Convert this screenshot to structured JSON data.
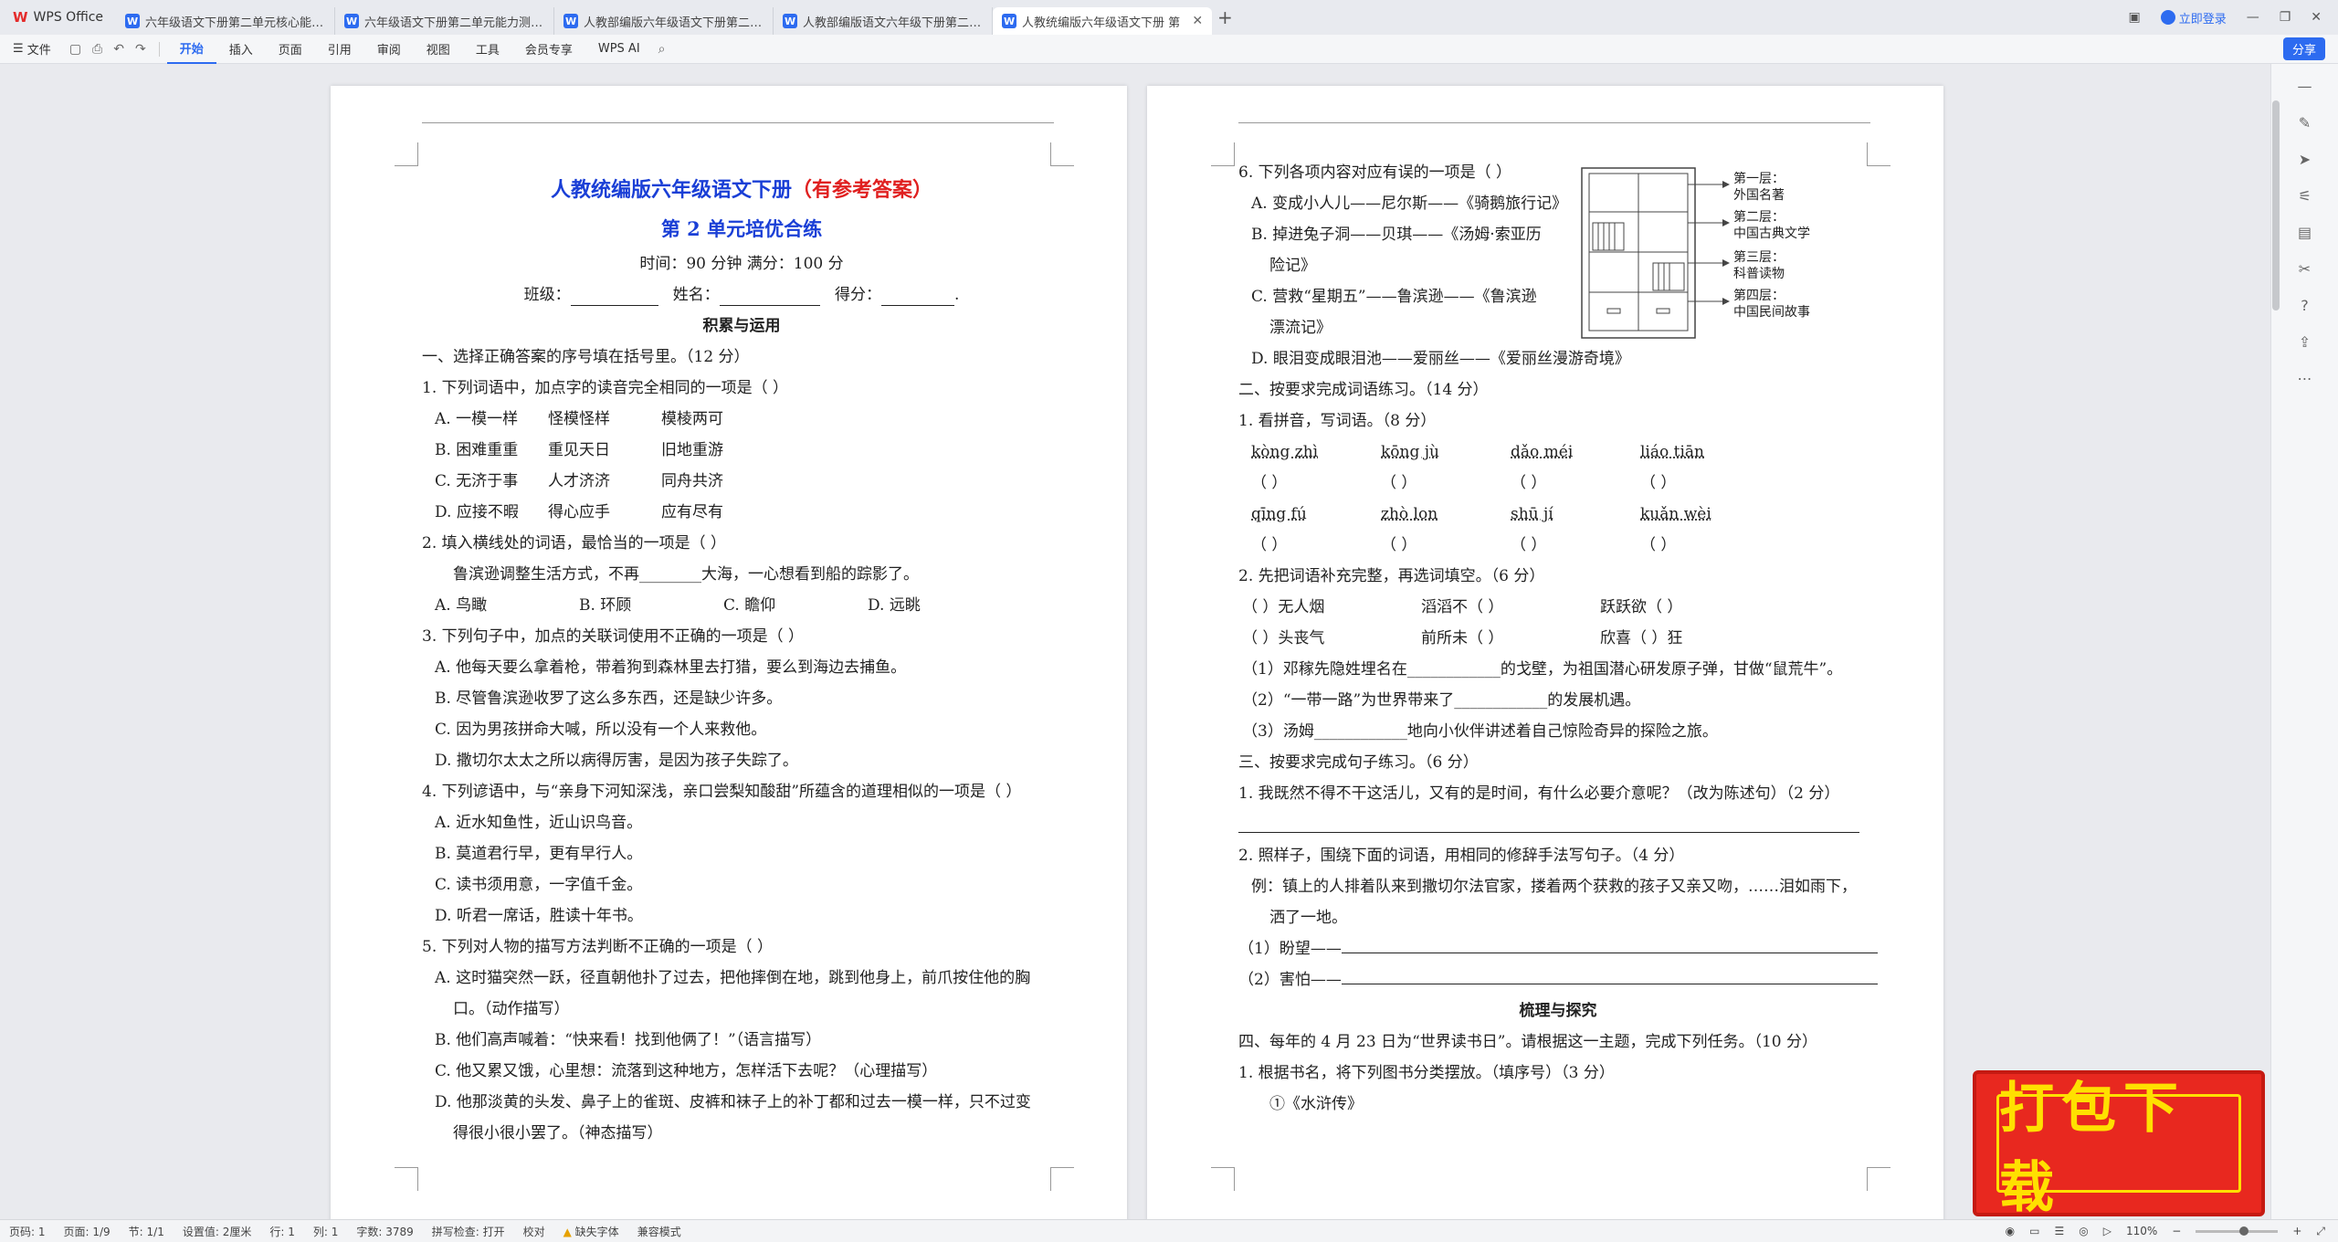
{
  "app": {
    "name": "WPS Office",
    "login": "立即登录",
    "share": "分享"
  },
  "tabs": [
    {
      "label": "六年级语文下册第二单元核心能力达标"
    },
    {
      "label": "六年级语文下册第二单元能力测试卷"
    },
    {
      "label": "人教部编版六年级语文下册第二单元"
    },
    {
      "label": "人教部编版语文六年级下册第二单元"
    },
    {
      "label": "人教统编版六年级语文下册 第"
    }
  ],
  "menu": {
    "file": "文件",
    "items": [
      "开始",
      "插入",
      "页面",
      "引用",
      "审阅",
      "视图",
      "工具",
      "会员专享"
    ],
    "ai": "WPS AI"
  },
  "page1": {
    "title": "人教统编版六年级语文下册",
    "title_ans": "（有参考答案）",
    "subtitle": "第 2 单元培优合练",
    "time": "时间：90 分钟  满分：100 分",
    "class_label": "班级：",
    "name_label": "姓名：",
    "score_label": "得分：",
    "section1": "积累与运用",
    "lines": [
      "一、选择正确答案的序号填在括号里。（12 分）",
      "1. 下列词语中，加点字的读音完全相同的一项是（     ）"
    ],
    "q1": [
      [
        "A. 一模一样",
        "怪模怪样",
        "模棱两可"
      ],
      [
        "B. 困难重重",
        "重见天日",
        "旧地重游"
      ],
      [
        "C. 无济于事",
        "人才济济",
        "同舟共济"
      ],
      [
        "D. 应接不暇",
        "得心应手",
        "应有尽有"
      ]
    ],
    "q2": "2. 填入横线处的词语，最恰当的一项是（     ）",
    "q2s": "鲁滨逊调整生活方式，不再________大海，一心想看到船的踪影了。",
    "q2o": [
      "A. 鸟瞰",
      "B. 环顾",
      "C. 瞻仰",
      "D. 远眺"
    ],
    "q3": "3. 下列句子中，加点的关联词使用不正确的一项是（     ）",
    "q3o": [
      "A. 他每天要么拿着枪，带着狗到森林里去打猎，要么到海边去捕鱼。",
      "B. 尽管鲁滨逊收罗了这么多东西，还是缺少许多。",
      "C. 因为男孩拼命大喊，所以没有一个人来救他。",
      "D. 撒切尔太太之所以病得厉害，是因为孩子失踪了。"
    ],
    "q4": "4. 下列谚语中，与“亲身下河知深浅，亲口尝梨知酸甜”所蕴含的道理相似的一项是（     ）",
    "q4o": [
      "A. 近水知鱼性，近山识鸟音。",
      "B. 莫道君行早，更有早行人。",
      "C. 读书须用意，一字值千金。",
      "D. 听君一席话，胜读十年书。"
    ],
    "q5": "5. 下列对人物的描写方法判断不正确的一项是（     ）",
    "q5o": [
      "A. 这时猫突然一跃，径直朝他扑了过去，把他摔倒在地，跳到他身上，前爪按住他的胸",
      "口。（动作描写）",
      "B. 他们高声喊着：“快来看！找到他俩了！”（语言描写）",
      "C. 他又累又饿，心里想：流落到这种地方，怎样活下去呢？（心理描写）",
      "D. 他那淡黄的头发、鼻子上的雀斑、皮裤和袜子上的补丁都和过去一模一样，只不过变",
      "得很小很小罢了。（神态描写）"
    ]
  },
  "page2": {
    "q6": "6. 下列各项内容对应有误的一项是（     ）",
    "q6o": [
      "A. 变成小人儿——尼尔斯——《骑鹅旅行记》",
      "B. 掉进兔子洞——贝琪——《汤姆·索亚历",
      "险记》",
      "C. 营救“星期五”——鲁滨逊——《鲁滨逊",
      "漂流记》",
      "D. 眼泪变成眼泪池——爱丽丝——《爱丽丝漫游奇境》"
    ],
    "shelf": [
      "第一层：",
      "外国名著",
      "第二层：",
      "中国古典文学",
      "第三层：",
      "科普读物",
      "第四层：",
      "中国民间故事"
    ],
    "s2": "二、按要求完成词语练习。（14 分）",
    "p1": "1. 看拼音，写词语。（8 分）",
    "pinyin1": [
      "kòng zhì",
      "kōng jù",
      "dǎo méi",
      "liáo tiān"
    ],
    "pinyin2": [
      "qīng fú",
      "zhò lon",
      "shū jí",
      "kuǎn wèi"
    ],
    "paren": "（        ）",
    "p2": "2. 先把词语补充完整，再选词填空。（6 分）",
    "fill1": [
      "（    ）无人烟",
      "滔滔不（    ）",
      "跃跃欲（    ）"
    ],
    "fill2": [
      "（    ）头丧气",
      "前所未（    ）",
      "欣喜（    ）狂"
    ],
    "f1": "（1）邓稼先隐姓埋名在____________的戈壁，为祖国潜心研发原子弹，甘做“鼠荒牛”。",
    "f2": "（2）“一带一路”为世界带来了____________的发展机遇。",
    "f3": "（3）汤姆____________地向小伙伴讲述着自己惊险奇异的探险之旅。",
    "s3": "三、按要求完成句子练习。（6 分）",
    "s3q1": "1. 我既然不得不干这活儿，又有的是时间，有什么必要介意呢？（改为陈述句）（2 分）",
    "s3q2": "2. 照样子，围绕下面的词语，用相同的修辞手法写句子。（4 分）",
    "ex1": "例：镇上的人排着队来到撒切尔法官家，搂着两个获救的孩子又亲又吻，……泪如雨下，",
    "ex2": "洒了一地。",
    "w1": "（1）盼望——",
    "w2": "（2）害怕——",
    "sec2": "梳理与探究",
    "s4": "四、每年的 4 月 23 日为“世界读书日”。请根据这一主题，完成下列任务。（10 分）",
    "s4q1": "1. 根据书名，将下列图书分类摆放。（填序号）（3 分）",
    "book1": "①《水浒传》"
  },
  "status": {
    "page": "页码: 1",
    "pages": "页面: 1/9",
    "section": "节: 1/1",
    "setting": "设置值: 2厘米",
    "row": "行: 1",
    "col": "列: 1",
    "words": "字数: 3789",
    "spell": "拼写检查: 打开",
    "proof": "校对",
    "font": "缺失字体",
    "compat": "兼容模式",
    "zoom": "110%"
  },
  "promo": {
    "text": "打包下载"
  }
}
